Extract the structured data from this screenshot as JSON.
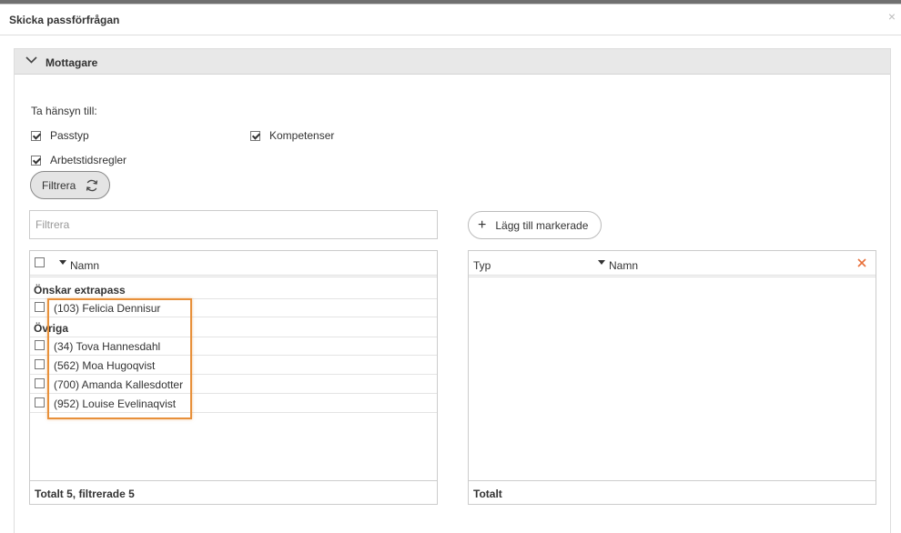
{
  "dialog": {
    "title": "Skicka passförfrågan",
    "close_glyph": "×"
  },
  "section": {
    "title": "Mottagare",
    "collapse_icon": "chevron-down-icon"
  },
  "considerations": {
    "label": "Ta hänsyn till:",
    "options": [
      {
        "label": "Passtyp",
        "checked": true
      },
      {
        "label": "Kompetenser",
        "checked": true
      },
      {
        "label": "Arbetstidsregler",
        "checked": true
      }
    ]
  },
  "filter_button": {
    "label": "Filtrera",
    "icon": "refresh-icon"
  },
  "search": {
    "placeholder": "Filtrera",
    "value": ""
  },
  "add_button": {
    "label": "Lägg till markerade",
    "icon": "plus-icon"
  },
  "left_list": {
    "column_name": "Namn",
    "groups": [
      {
        "title": "Önskar extrapass",
        "items": [
          "(103) Felicia Dennisur"
        ]
      },
      {
        "title": "Övriga",
        "items": [
          "(34) Tova Hannesdahl",
          "(562) Moa Hugoqvist",
          "(700) Amanda Kallesdotter",
          "(952) Louise Evelinaqvist"
        ]
      }
    ],
    "footer": "Totalt 5, filtrerade 5"
  },
  "right_list": {
    "column_type": "Typ",
    "column_name": "Namn",
    "clear_icon": "close-icon",
    "footer": "Totalt"
  },
  "colors": {
    "highlight": "#e8903a",
    "clear_icon": "#e8703a",
    "panel_header": "#e8e8e8"
  }
}
